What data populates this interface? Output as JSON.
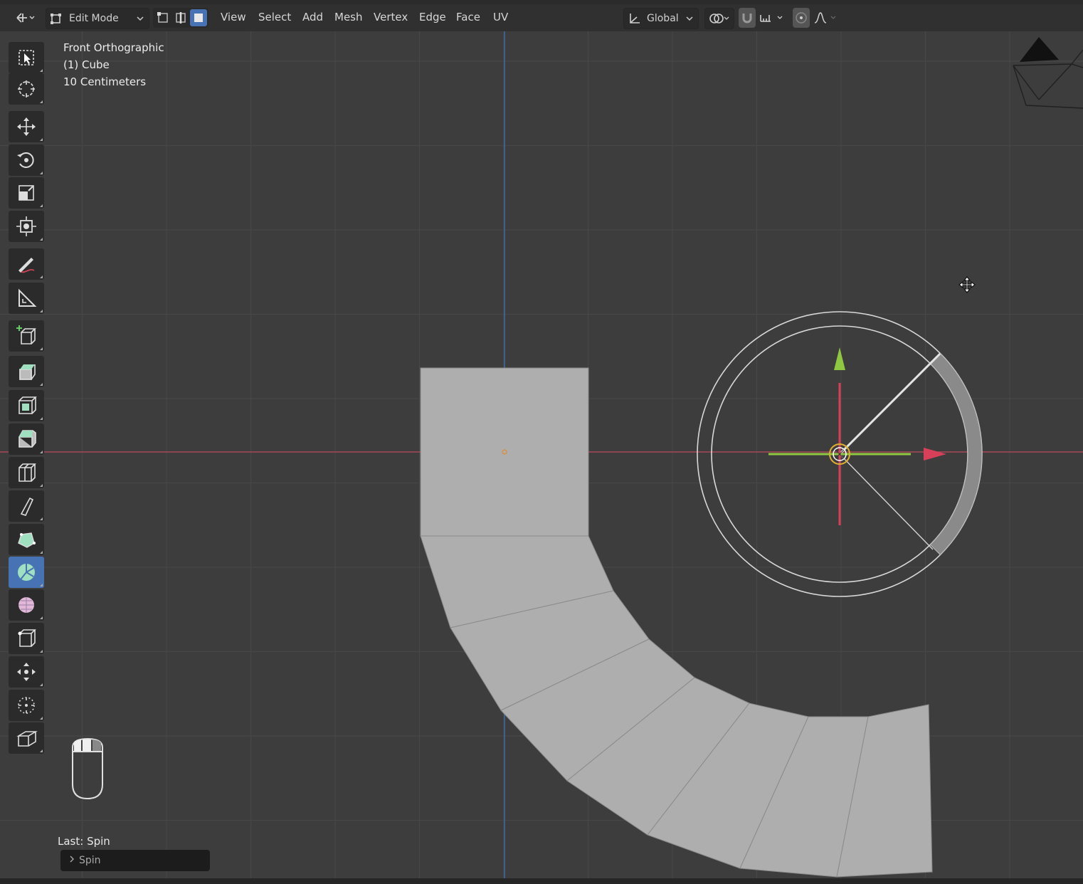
{
  "header": {
    "mode_label": "Edit Mode",
    "menus": [
      "View",
      "Select",
      "Add",
      "Mesh",
      "Vertex",
      "Edge",
      "Face",
      "UV"
    ],
    "transform_orientation": "Global"
  },
  "viewport": {
    "view_name": "Front Orthographic",
    "object_name": "(1) Cube",
    "grid_scale": "10 Centimeters"
  },
  "last_operation": {
    "label": "Last: Spin",
    "panel_label": "Spin"
  },
  "toolbar": {
    "tools": [
      "select-box-icon",
      "cursor-icon",
      "move-icon",
      "rotate-icon",
      "scale-icon",
      "transform-icon",
      "annotate-icon",
      "measure-icon",
      "add-cube-icon",
      "extrude-region-icon",
      "inset-faces-icon",
      "bevel-icon",
      "loop-cut-icon",
      "knife-icon",
      "poly-build-icon",
      "spin-icon",
      "smooth-icon",
      "edge-slide-icon",
      "shrink-fatten-icon",
      "shear-icon",
      "rip-region-icon"
    ],
    "active_tool": "spin-icon"
  },
  "colors": {
    "background": "#3d3d3d",
    "grid_line": "#474747",
    "x_axis": "#a8485a",
    "z_axis": "#3e6aa6",
    "mesh_face": "#aeaeae",
    "active_tool": "#4772b3",
    "gizmo_green": "#8fc840",
    "gizmo_red": "#d8405a"
  }
}
